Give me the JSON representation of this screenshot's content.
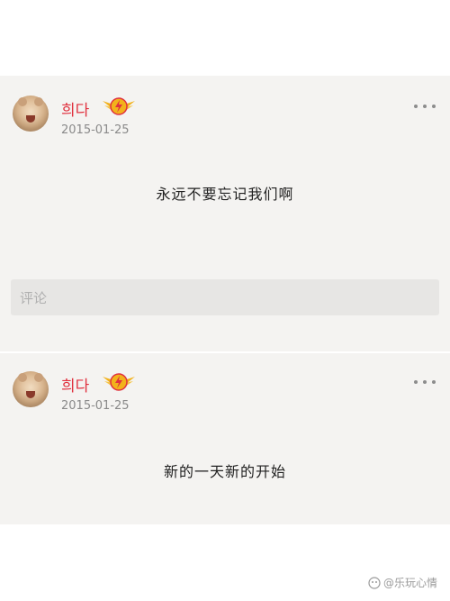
{
  "posts": [
    {
      "username": "희다",
      "date": "2015-01-25",
      "content": "永远不要忘记我们啊",
      "comment_placeholder": "评论"
    },
    {
      "username": "희다",
      "date": "2015-01-25",
      "content": "新的一天新的开始"
    }
  ],
  "watermark": "@乐玩心情",
  "colors": {
    "username": "#e0313f",
    "badge_gold": "#f2b21b",
    "badge_red": "#e0313f",
    "card_bg": "#f4f3f1"
  },
  "icons": {
    "badge": "crown-wings-badge-icon",
    "more": "more-dots-icon",
    "watermark": "app-logo-icon"
  }
}
